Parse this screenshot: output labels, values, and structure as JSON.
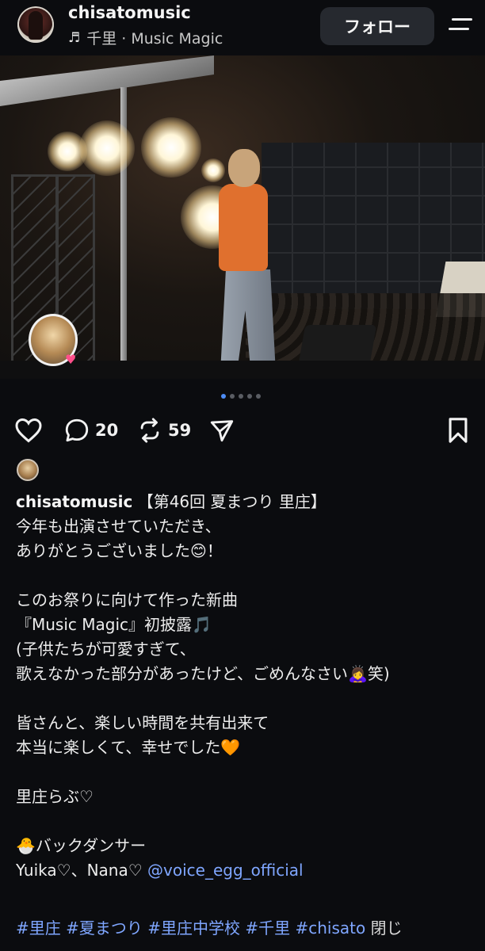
{
  "header": {
    "username": "chisatomusic",
    "music_note_icon": "music-note-icon",
    "music_text": "千里 · Music Magic",
    "follow_label": "フォロー"
  },
  "carousel": {
    "slide_count": 5,
    "active_index": 0
  },
  "actions": {
    "reply_count": "20",
    "repost_count": "59"
  },
  "caption": {
    "username": "chisatomusic",
    "first_line_text": " 【第46回 夏まつり 里庄】",
    "lines": [
      "今年も出演させていただき、",
      "ありがとうございました😊！",
      "",
      "このお祭りに向けて作った新曲",
      "『Music Magic』初披露🎵",
      "(子供たちが可愛すぎて、",
      "歌えなかった部分があったけど、ごめんなさい🙇‍♀️笑)",
      "",
      "皆さんと、楽しい時間を共有出来て",
      "本当に楽しくて、幸せでした🧡",
      "",
      "里庄らぶ♡",
      "",
      "🐣バックダンサー"
    ],
    "dancer_line_prefix": "Yuika♡、Nana♡ ",
    "mention": "@voice_egg_official"
  },
  "tags": {
    "items": [
      "#里庄",
      "#夏まつり",
      "#里庄中学校",
      "#千里",
      "#chisato"
    ],
    "close_label": "閉じ"
  },
  "colors": {
    "background": "#0b0c0f",
    "link": "#7fa6ff",
    "active_dot": "#4d8df6"
  }
}
